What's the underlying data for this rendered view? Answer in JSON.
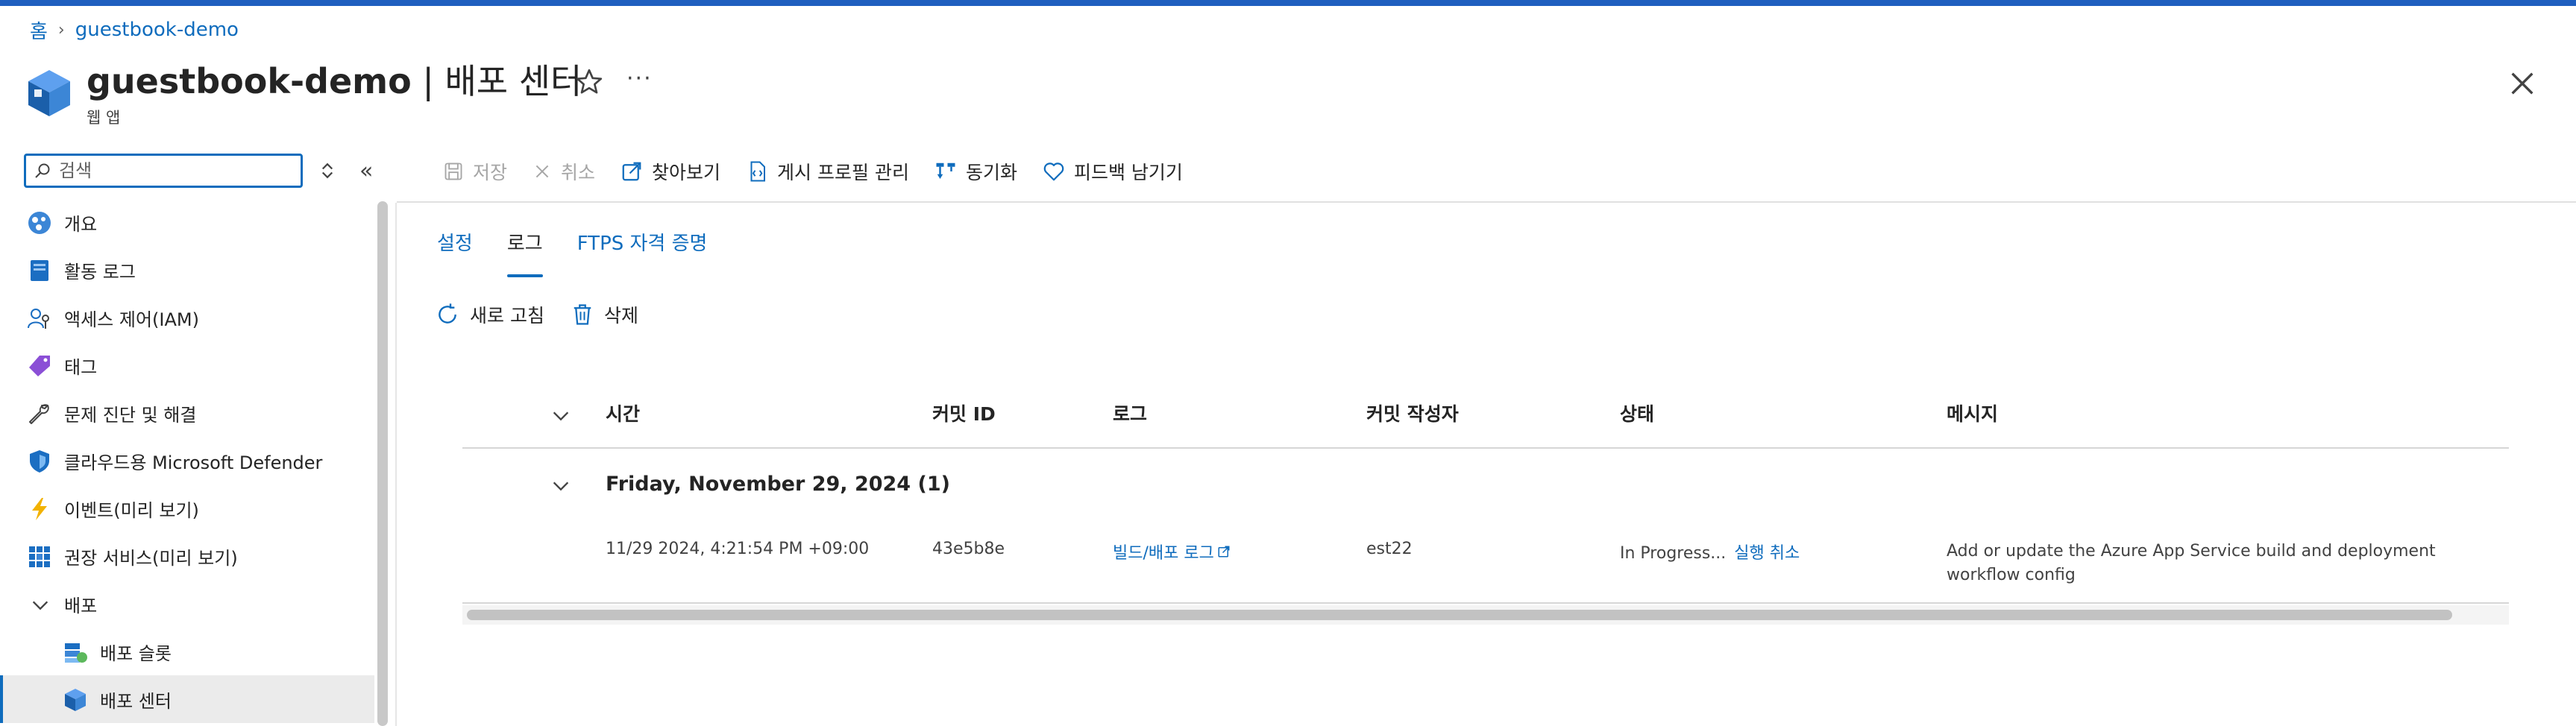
{
  "breadcrumb": {
    "home": "홈",
    "resource": "guestbook-demo"
  },
  "header": {
    "resource_name": "guestbook-demo",
    "page_name": "| 배포 센터",
    "resource_type": "웹 앱"
  },
  "sidebar": {
    "search_placeholder": "검색",
    "items": [
      {
        "label": "개요",
        "icon": "overview-icon"
      },
      {
        "label": "활동 로그",
        "icon": "activity-log-icon"
      },
      {
        "label": "액세스 제어(IAM)",
        "icon": "iam-icon"
      },
      {
        "label": "태그",
        "icon": "tag-icon"
      },
      {
        "label": "문제 진단 및 해결",
        "icon": "wrench-icon"
      },
      {
        "label": "클라우드용 Microsoft Defender",
        "icon": "shield-icon"
      },
      {
        "label": "이벤트(미리 보기)",
        "icon": "lightning-icon"
      },
      {
        "label": "권장 서비스(미리 보기)",
        "icon": "grid-icon"
      },
      {
        "label": "배포",
        "icon": "chevron-down-icon"
      },
      {
        "label": "배포 슬롯",
        "icon": "deployment-slots-icon"
      },
      {
        "label": "배포 센터",
        "icon": "deployment-center-icon"
      }
    ]
  },
  "commands": {
    "save": "저장",
    "cancel": "취소",
    "browse": "찾아보기",
    "manage_publish_profile": "게시 프로필 관리",
    "sync": "동기화",
    "feedback": "피드백 남기기"
  },
  "tabs": [
    "설정",
    "로그",
    "FTPS 자격 증명"
  ],
  "actions": {
    "refresh": "새로 고침",
    "delete": "삭제"
  },
  "table": {
    "columns": [
      "시간",
      "커밋 ID",
      "로그",
      "커밋 작성자",
      "상태",
      "메시지"
    ],
    "group_title": "Friday, November 29, 2024 (1)",
    "rows": [
      {
        "time": "11/29 2024, 4:21:54 PM +09:00",
        "commit_id": "43e5b8e",
        "log": "빌드/배포 로그",
        "author": "est22",
        "status": "In Progress...",
        "status_action": "실행 취소",
        "message": "Add or update the Azure App Service build and deployment workflow config"
      }
    ]
  },
  "colors": {
    "accent": "#0f6cbd",
    "top_bar": "#1f5fbf"
  }
}
